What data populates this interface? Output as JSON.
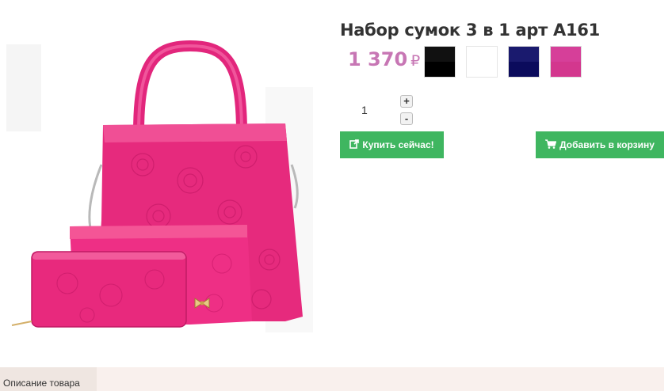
{
  "product": {
    "title": "Набор сумок 3 в 1 арт A161",
    "price": "1 370",
    "currency": "₽",
    "image_icon": "handbag-set-image"
  },
  "colors": {
    "swatches": [
      {
        "name": "black",
        "top": "#111111",
        "bottom": "#000000"
      },
      {
        "name": "white",
        "top": "#ffffff",
        "bottom": "#ffffff"
      },
      {
        "name": "navy",
        "top": "#1a1a6e",
        "bottom": "#0b0b5c"
      },
      {
        "name": "pink",
        "top": "#d63f99",
        "bottom": "#d3378e"
      }
    ]
  },
  "quantity": {
    "value": "1",
    "plus_label": "+",
    "minus_label": "-"
  },
  "actions": {
    "buy_now_label": "Купить сейчас!",
    "buy_now_icon": "external-link-icon",
    "add_to_cart_label": "Добавить в корзину",
    "add_to_cart_icon": "cart-icon",
    "button_color": "#3fb660"
  },
  "tabs": {
    "description_label": "Описание товара"
  }
}
